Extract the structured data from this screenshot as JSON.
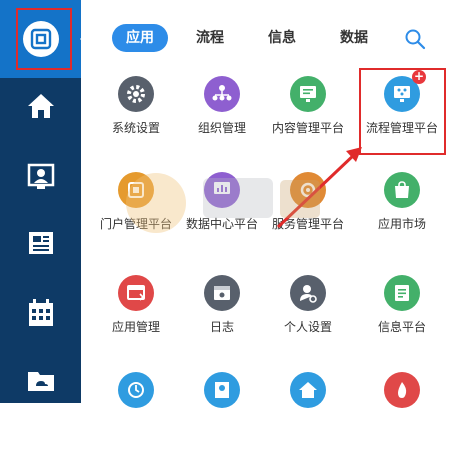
{
  "sidebar": {
    "items": [
      {
        "icon": "portal-logo-icon"
      },
      {
        "icon": "home-icon"
      },
      {
        "icon": "contact-icon"
      },
      {
        "icon": "news-icon"
      },
      {
        "icon": "calendar-icon"
      },
      {
        "icon": "folder-cloud-icon"
      }
    ]
  },
  "tabs": [
    {
      "label": "应用",
      "active": true
    },
    {
      "label": "流程",
      "active": false
    },
    {
      "label": "信息",
      "active": false
    },
    {
      "label": "数据",
      "active": false
    }
  ],
  "apps": [
    {
      "label": "系统设置",
      "color": "#58606c",
      "icon": "gear-icon"
    },
    {
      "label": "组织管理",
      "color": "#8e5fd0",
      "icon": "org-chart-icon"
    },
    {
      "label": "内容管理平台",
      "color": "#43b06a",
      "icon": "content-monitor-icon"
    },
    {
      "label": "流程管理平台",
      "color": "#2f9ce0",
      "icon": "process-monitor-icon",
      "badge": "+"
    },
    {
      "label": "门户管理平台",
      "color": "#e59a2e",
      "icon": "portal-icon"
    },
    {
      "label": "数据中心平台",
      "color": "#8e5fd0",
      "icon": "data-center-icon"
    },
    {
      "label": "服务管理平台",
      "color": "#e08a35",
      "icon": "service-icon"
    },
    {
      "label": "应用市场",
      "color": "#43b06a",
      "icon": "shopping-bag-icon"
    },
    {
      "label": "应用管理",
      "color": "#e04848",
      "icon": "app-manage-icon"
    },
    {
      "label": "日志",
      "color": "#58606c",
      "icon": "log-icon"
    },
    {
      "label": "个人设置",
      "color": "#58606c",
      "icon": "user-settings-icon"
    },
    {
      "label": "信息平台",
      "color": "#43b06a",
      "icon": "info-icon"
    },
    {
      "label": "",
      "color": "#2f9ce0",
      "icon": "clock-icon"
    },
    {
      "label": "",
      "color": "#2f9ce0",
      "icon": "profile-icon"
    },
    {
      "label": "",
      "color": "#2f9ce0",
      "icon": "house-icon"
    },
    {
      "label": "",
      "color": "#e04848",
      "icon": "flame-icon"
    }
  ]
}
